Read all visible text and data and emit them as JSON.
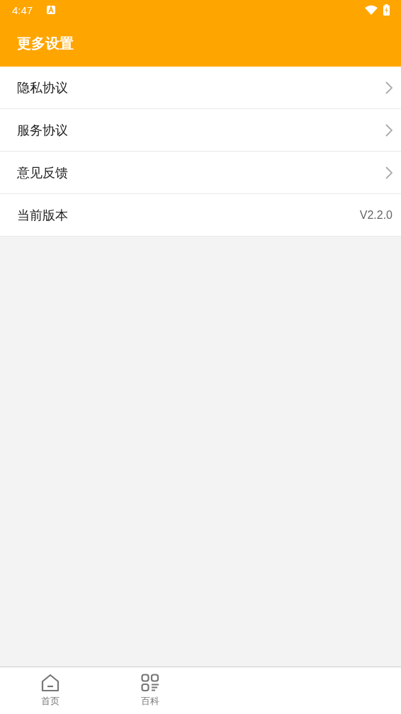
{
  "status_bar": {
    "time": "4:47"
  },
  "header": {
    "title": "更多设置"
  },
  "settings": [
    {
      "label": "隐私协议",
      "kind": "link"
    },
    {
      "label": "服务协议",
      "kind": "link"
    },
    {
      "label": "意见反馈",
      "kind": "link"
    },
    {
      "label": "当前版本",
      "kind": "value",
      "value": "V2.2.0"
    }
  ],
  "tab_bar": [
    {
      "label": "首页",
      "kind": "home",
      "selected": false
    },
    {
      "label": "百科",
      "kind": "catalog",
      "selected": false
    }
  ]
}
